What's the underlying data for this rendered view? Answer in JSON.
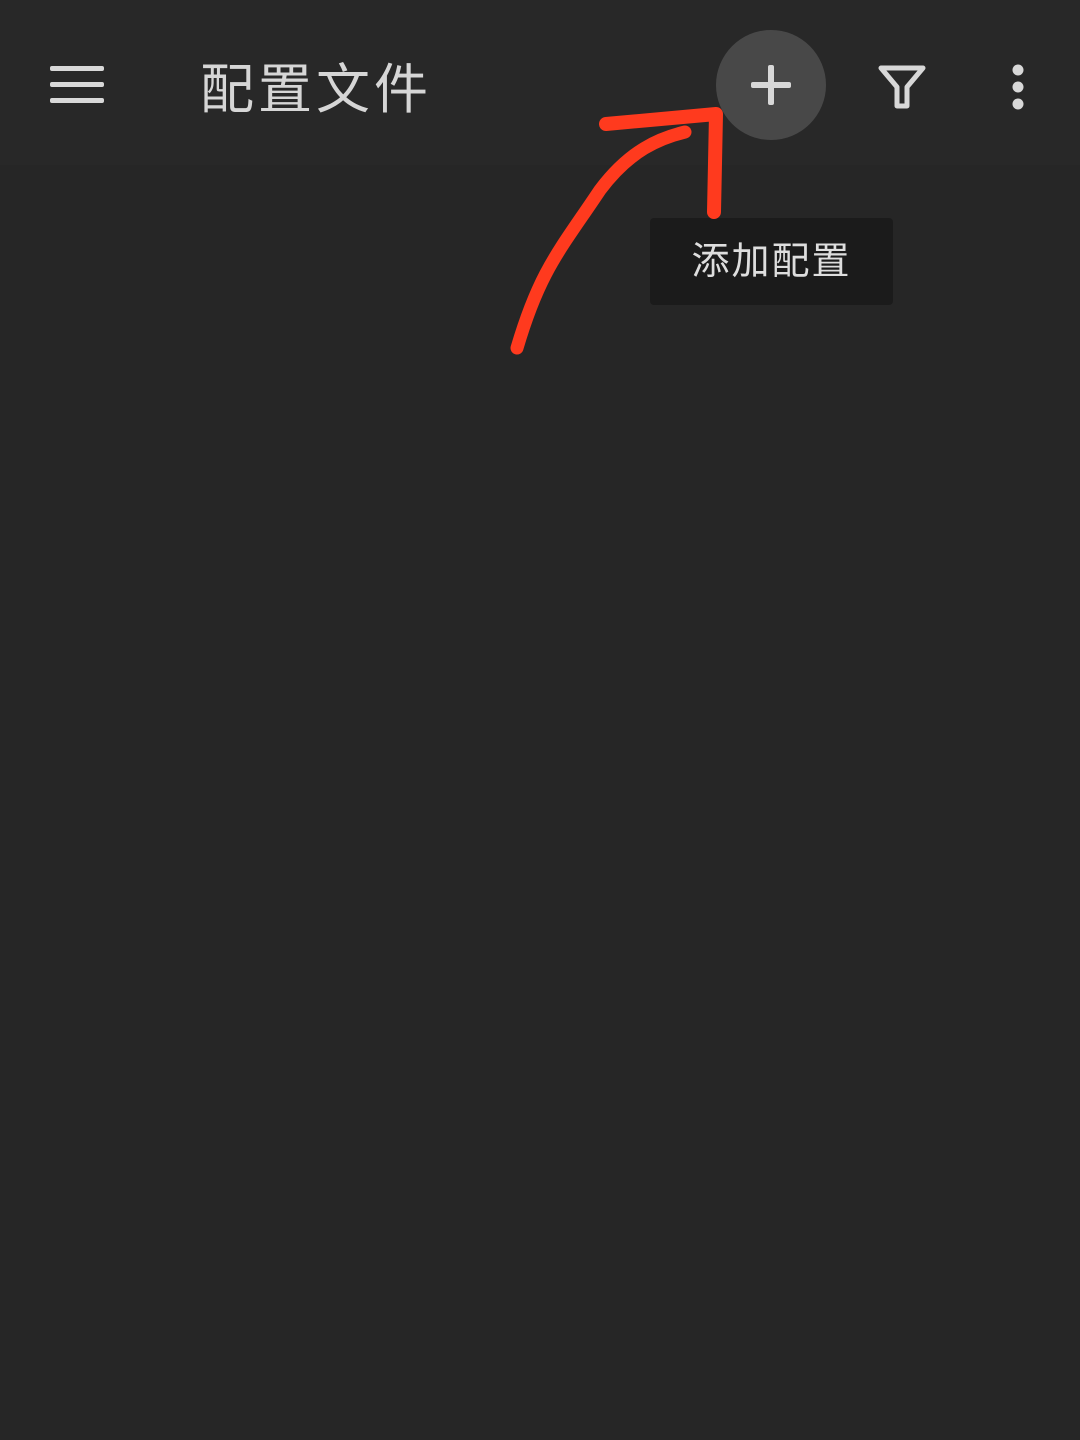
{
  "app_bar": {
    "title": "配置文件",
    "icons": {
      "menu": "menu-icon",
      "add": "plus-icon",
      "filter": "filter-icon",
      "overflow": "more-vert-icon"
    }
  },
  "tooltip": {
    "text": "添加配置"
  },
  "colors": {
    "background": "#262626",
    "app_bar": "#282828",
    "icon": "#d8d8d8",
    "add_button_bg": "#484848",
    "tooltip_bg": "#1b1b1b",
    "annotation": "#ff3a1e"
  }
}
